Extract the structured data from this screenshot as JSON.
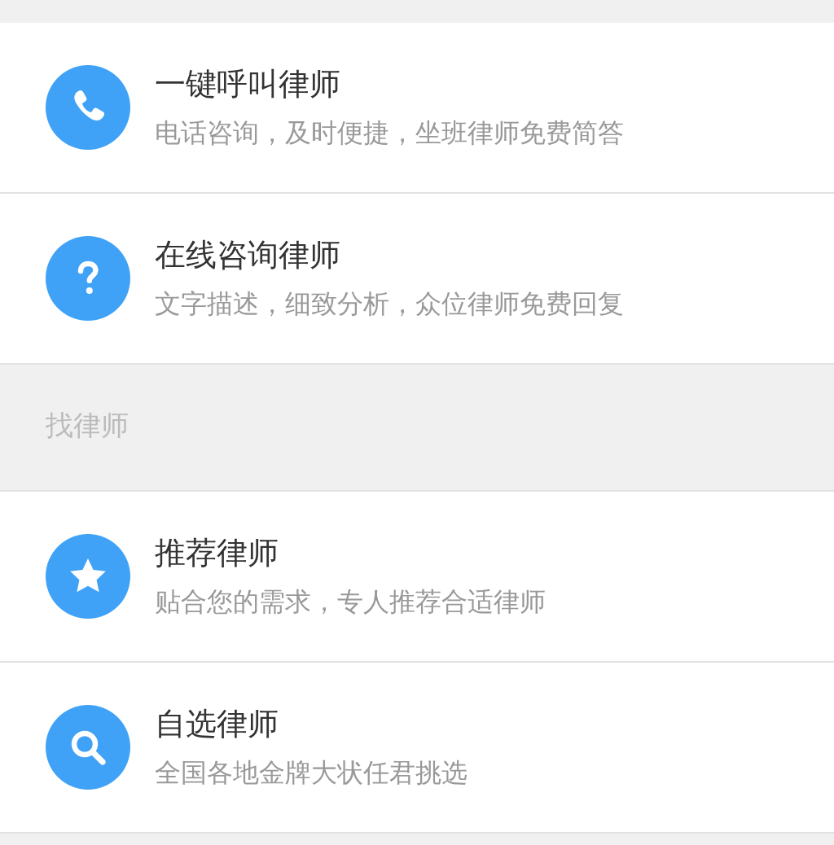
{
  "groups": [
    {
      "items": [
        {
          "title": "一键呼叫律师",
          "subtitle": "电话咨询，及时便捷，坐班律师免费简答"
        },
        {
          "title": "在线咨询律师",
          "subtitle": "文字描述，细致分析，众位律师免费回复"
        }
      ]
    },
    {
      "header": "找律师",
      "items": [
        {
          "title": "推荐律师",
          "subtitle": "贴合您的需求，专人推荐合适律师"
        },
        {
          "title": "自选律师",
          "subtitle": "全国各地金牌大状任君挑选"
        }
      ]
    }
  ]
}
